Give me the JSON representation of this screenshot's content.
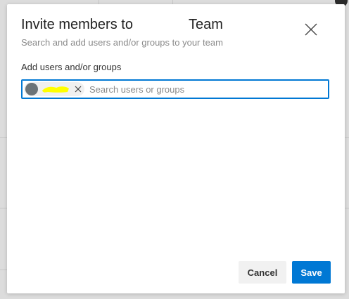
{
  "dialog": {
    "title": "Invite members to",
    "title_team": "Team",
    "subtitle": "Search and add users and/or groups to your team",
    "close_icon": "close-icon"
  },
  "picker": {
    "label": "Add users and/or groups",
    "placeholder": "Search users or groups",
    "value": "",
    "selected": [
      {
        "avatar_color": "#6b7378",
        "name_redacted": true,
        "remove_icon": "close-icon"
      }
    ]
  },
  "actions": {
    "cancel_label": "Cancel",
    "save_label": "Save"
  },
  "colors": {
    "accent": "#0078d4",
    "redaction_highlight": "#ffff00"
  }
}
